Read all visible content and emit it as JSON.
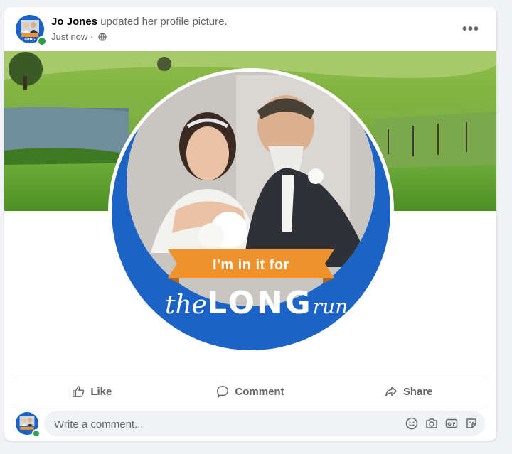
{
  "post": {
    "author": "Jo Jones",
    "action_text": " updated her profile picture.",
    "timestamp": "Just now",
    "separator": " · ",
    "more_label": "•••"
  },
  "badge": {
    "tagline": "I'm in it for",
    "wordmark_the": "the",
    "wordmark_long": "LONG",
    "wordmark_run": "run"
  },
  "actions": {
    "like": "Like",
    "comment": "Comment",
    "share": "Share"
  },
  "comment_box": {
    "placeholder": "Write a comment..."
  },
  "colors": {
    "brand_blue": "#1c63c8",
    "ribbon_orange": "#f0922b",
    "online_green": "#31a24c",
    "text_secondary": "#65676b"
  },
  "icons": [
    "globe-icon",
    "more-icon",
    "like-icon",
    "comment-icon",
    "share-icon",
    "emoji-icon",
    "camera-icon",
    "gif-icon",
    "sticker-icon"
  ]
}
